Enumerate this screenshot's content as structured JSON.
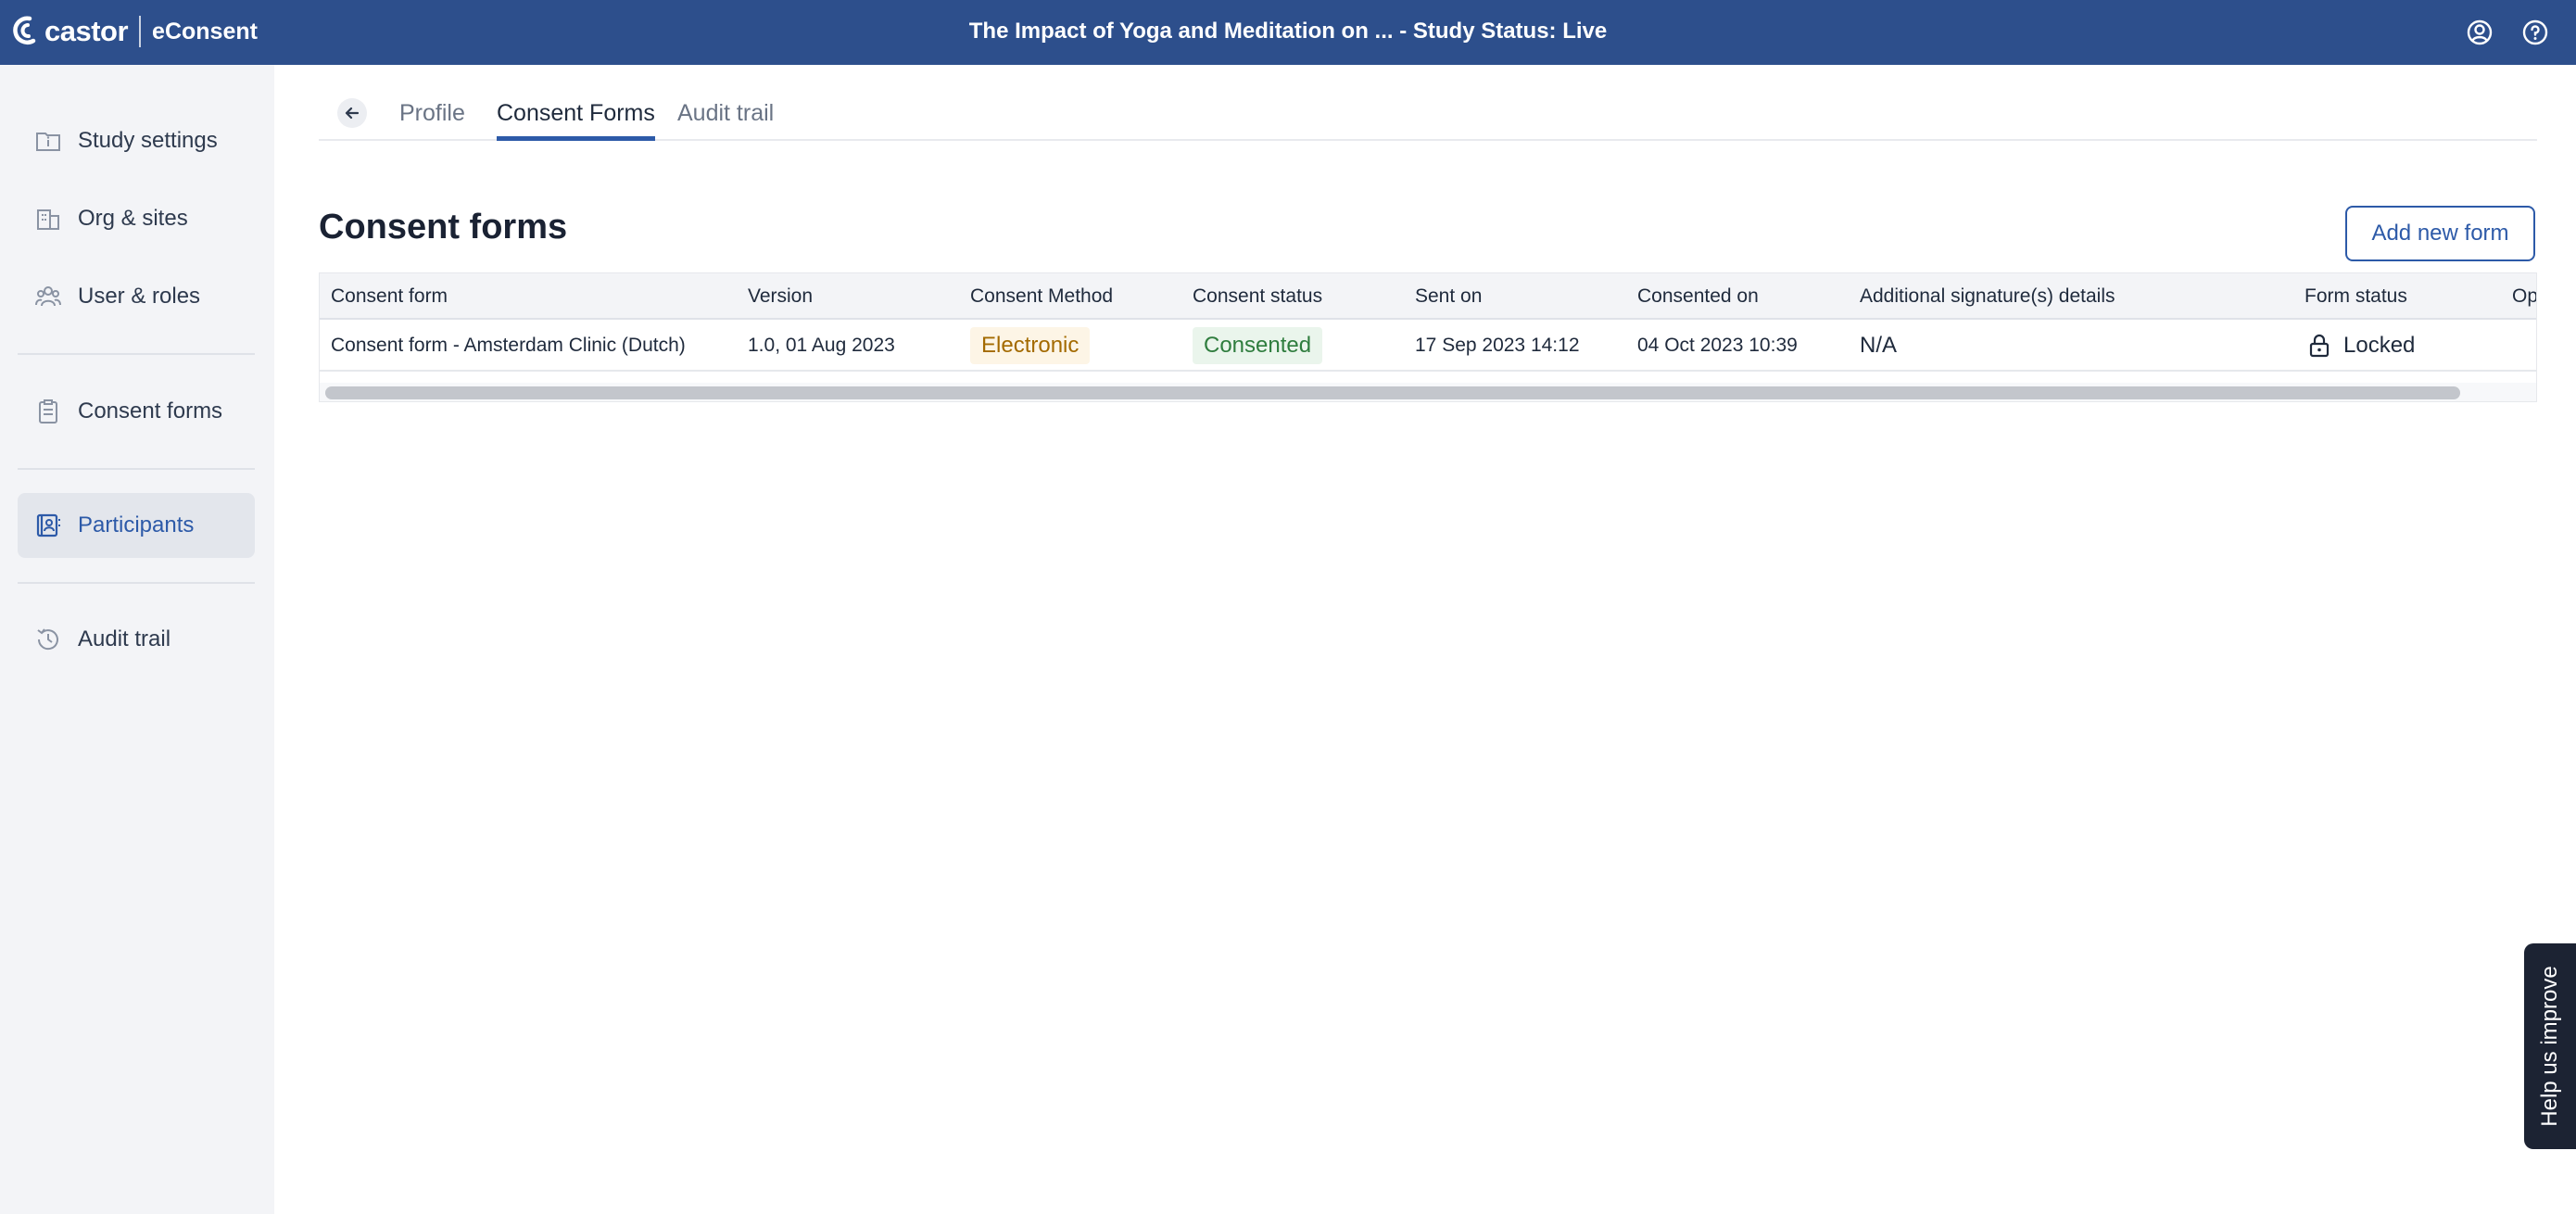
{
  "header": {
    "brand": "castor",
    "product": "eConsent",
    "title": "The Impact of Yoga and Meditation on ...  - Study Status: Live",
    "icons": [
      "user-circle-icon",
      "help-circle-icon"
    ],
    "color": "#2d4f8c"
  },
  "sidebar": {
    "items": [
      {
        "label": "Study settings",
        "icon": "folder-info-icon"
      },
      {
        "label": "Org & sites",
        "icon": "building-icon"
      },
      {
        "label": "User & roles",
        "icon": "users-icon"
      },
      {
        "label": "Consent forms",
        "icon": "clipboard-icon"
      },
      {
        "label": "Participants",
        "icon": "participants-icon",
        "active": true
      },
      {
        "label": "Audit trail",
        "icon": "history-icon"
      }
    ]
  },
  "tabs": {
    "items": [
      {
        "label": "Profile"
      },
      {
        "label": "Consent Forms",
        "active": true
      },
      {
        "label": "Audit trail"
      }
    ]
  },
  "main": {
    "title": "Consent forms",
    "add_button": "Add new form",
    "table": {
      "columns": [
        "Consent form",
        "Version",
        "Consent Method",
        "Consent status",
        "Sent on",
        "Consented on",
        "Additional signature(s) details",
        "Form status",
        "Op"
      ],
      "rows": [
        {
          "form": "Consent form - Amsterdam Clinic (Dutch)",
          "version": "1.0, 01 Aug 2023",
          "method": "Electronic",
          "status": "Consented",
          "sent_on": "17 Sep 2023 14:12",
          "consented_on": "04 Oct 2023 10:39",
          "additional": "N/A",
          "form_status": "Locked"
        }
      ]
    }
  },
  "feedback": {
    "label": "Help us improve"
  },
  "colors": {
    "accent": "#2d5aa8",
    "method_text": "#a36a00",
    "status_text": "#2f7d3e"
  }
}
